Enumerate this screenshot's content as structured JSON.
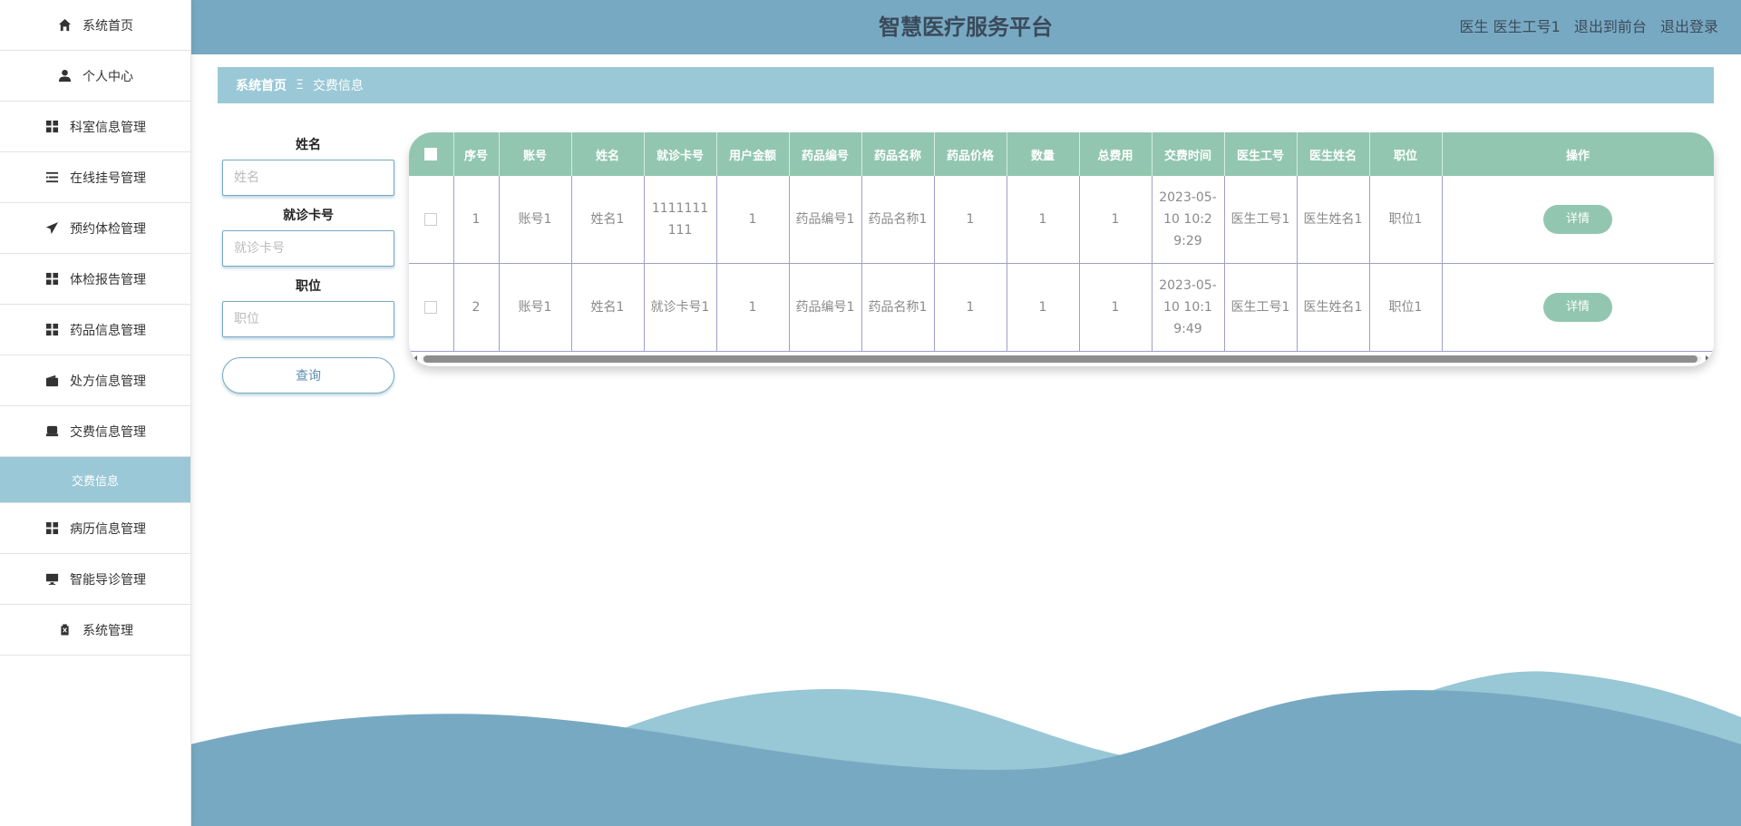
{
  "app": {
    "title": "智慧医疗服务平台"
  },
  "header": {
    "user_label": "医生 医生工号1",
    "back_front": "退出到前台",
    "logout": "退出登录"
  },
  "sidebar": {
    "items": [
      {
        "label": "系统首页",
        "icon": "home-icon"
      },
      {
        "label": "个人中心",
        "icon": "user-icon"
      },
      {
        "label": "科室信息管理",
        "icon": "grid-icon"
      },
      {
        "label": "在线挂号管理",
        "icon": "list-icon"
      },
      {
        "label": "预约体检管理",
        "icon": "send-icon"
      },
      {
        "label": "体检报告管理",
        "icon": "grid-icon"
      },
      {
        "label": "药品信息管理",
        "icon": "grid-icon"
      },
      {
        "label": "处方信息管理",
        "icon": "wallet-icon"
      },
      {
        "label": "交费信息管理",
        "icon": "printer-icon"
      },
      {
        "label": "交费信息",
        "icon": ""
      },
      {
        "label": "病历信息管理",
        "icon": "grid-icon"
      },
      {
        "label": "智能导诊管理",
        "icon": "monitor-icon"
      },
      {
        "label": "系统管理",
        "icon": "clipboard-icon"
      }
    ]
  },
  "breadcrumb": {
    "home": "系统首页",
    "separator": "Ξ",
    "current": "交费信息"
  },
  "search": {
    "name_label": "姓名",
    "name_placeholder": "姓名",
    "card_label": "就诊卡号",
    "card_placeholder": "就诊卡号",
    "position_label": "职位",
    "position_placeholder": "职位",
    "query_button": "查询"
  },
  "table": {
    "columns": [
      "序号",
      "账号",
      "姓名",
      "就诊卡号",
      "用户金额",
      "药品编号",
      "药品名称",
      "药品价格",
      "数量",
      "总费用",
      "交费时间",
      "医生工号",
      "医生姓名",
      "职位",
      "操作"
    ],
    "rows": [
      {
        "index": "1",
        "account": "账号1",
        "name": "姓名1",
        "card": "1111111111",
        "balance": "1",
        "drug_code": "药品编号1",
        "drug_name": "药品名称1",
        "drug_price": "1",
        "quantity": "1",
        "total": "1",
        "paid_time": "2023-05-10 10:29:29",
        "doctor_id": "医生工号1",
        "doctor_name": "医生姓名1",
        "position": "职位1",
        "action": "详情"
      },
      {
        "index": "2",
        "account": "账号1",
        "name": "姓名1",
        "card": "就诊卡号1",
        "balance": "1",
        "drug_code": "药品编号1",
        "drug_name": "药品名称1",
        "drug_price": "1",
        "quantity": "1",
        "total": "1",
        "paid_time": "2023-05-10 10:19:49",
        "doctor_id": "医生工号1",
        "doctor_name": "医生姓名1",
        "position": "职位1",
        "action": "详情"
      }
    ]
  },
  "colors": {
    "header": "#78a9c3",
    "breadcrumb": "#9ac8d6",
    "table_header": "#92c6b0",
    "wave_dark": "#78a9c3",
    "wave_light": "#98c7d5"
  }
}
